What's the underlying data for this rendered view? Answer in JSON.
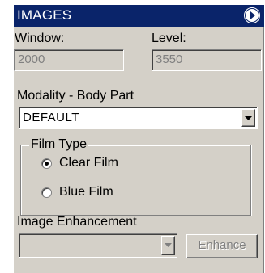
{
  "panel": {
    "title": "IMAGES",
    "collapse_icon": "chevron-right-circle-icon"
  },
  "window_level": {
    "window_label": "Window:",
    "window_value": "2000",
    "level_label": "Level:",
    "level_value": "3550"
  },
  "modality": {
    "label": "Modality - Body Part",
    "selected": "DEFAULT",
    "dropdown_icon": "triangle-down-icon"
  },
  "film_type": {
    "legend": "Film Type",
    "options": [
      {
        "label": "Clear Film",
        "checked": true
      },
      {
        "label": "Blue Film",
        "checked": false
      }
    ]
  },
  "enhancement": {
    "label": "Image Enhancement",
    "selected": "",
    "button_label": "Enhance",
    "dropdown_icon": "triangle-down-icon"
  }
}
